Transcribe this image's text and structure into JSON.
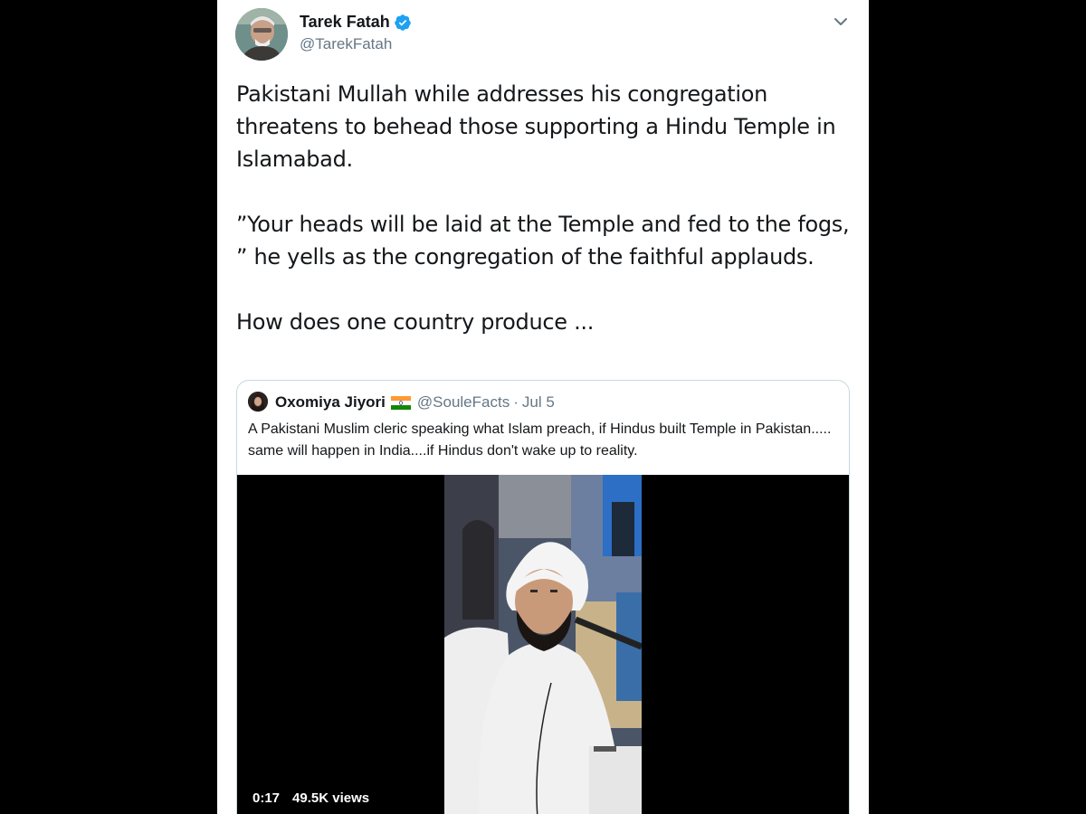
{
  "tweet": {
    "author_name": "Tarek Fatah",
    "author_handle": "@TarekFatah",
    "paragraphs": [
      "Pakistani Mullah while addresses his congregation threatens to behead those supporting a Hindu Temple in Islamabad.",
      "”Your heads will be laid at the Temple and fed to the fogs, ” he yells as the congregation of the faithful applauds.",
      "How does one country produce ..."
    ]
  },
  "quoted_tweet": {
    "author_name": "Oxomiya Jiyori",
    "author_handle": "@SouleFacts",
    "separator": "·",
    "date": "Jul 5",
    "text": "A Pakistani Muslim cleric speaking what Islam preach, if Hindus built Temple in Pakistan..... same will happen in India....if Hindus don't wake up to reality.",
    "video": {
      "duration": "0:17",
      "views": "49.5K views"
    }
  },
  "colors": {
    "background": "#000000",
    "card": "#ffffff",
    "text_primary": "#14171a",
    "text_secondary": "#657786",
    "verified": "#1da1f2",
    "border": "#ccd6dd"
  },
  "icons": [
    "verified-badge-icon",
    "chevron-down-icon",
    "india-flag-icon"
  ]
}
